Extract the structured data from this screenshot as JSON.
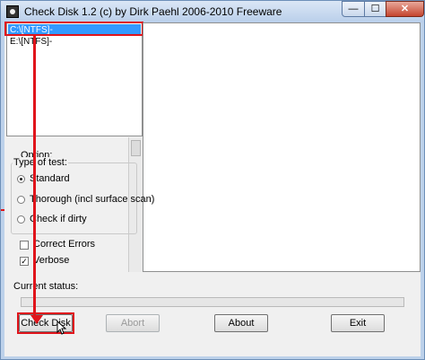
{
  "window": {
    "title": "Check Disk 1.2  (c) by Dirk Paehl  2006-2010 Freeware",
    "minimize_label": "—",
    "maximize_label": "☐",
    "close_label": "✕"
  },
  "drives": {
    "items": [
      {
        "label": "C:\\[NTFS]-",
        "selected": true
      },
      {
        "label": "E:\\[NTFS]-",
        "selected": false
      }
    ]
  },
  "options": {
    "label": "Option:",
    "type_group_label": "Type of test:",
    "radios": [
      {
        "label": "Standard",
        "checked": true
      },
      {
        "label": "Thorough (incl surface scan)",
        "checked": false
      },
      {
        "label": "Check if dirty",
        "checked": false
      }
    ],
    "checkboxes": [
      {
        "label": "Correct Errors",
        "checked": false
      },
      {
        "label": "Verbose",
        "checked": true
      }
    ]
  },
  "status": {
    "label": "Current status:",
    "progress": 0
  },
  "buttons": {
    "check_disk": "Check Disk",
    "abort": "Abort",
    "about": "About",
    "exit": "Exit"
  },
  "annotation_color": "#e0141b",
  "icons": [
    "app-icon",
    "pointer-cursor-icon"
  ]
}
